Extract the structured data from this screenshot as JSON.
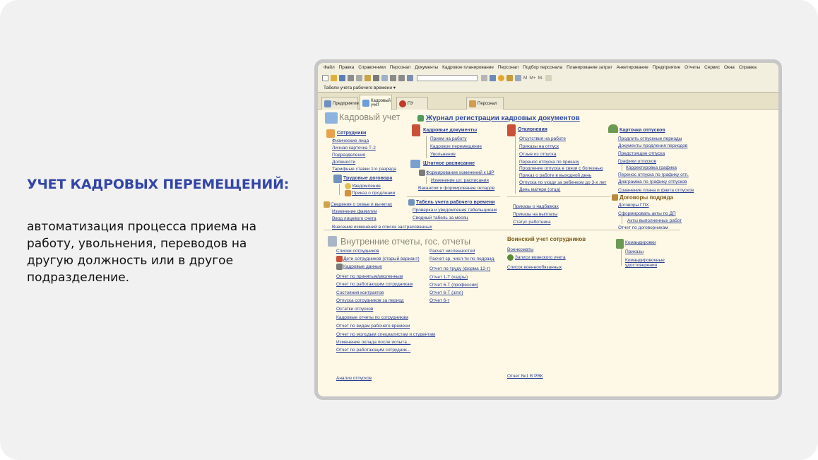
{
  "slide": {
    "title": "УЧЕТ КАДРОВЫХ ПЕРЕМЕЩЕНИЙ:",
    "description": "автоматизация процесса приема на работу, увольнения, переводов на другую должность или в другое подразделение."
  },
  "menu": [
    "Файл",
    "Правка",
    "Справочники",
    "Персонал",
    "Документы",
    "Кадровое планирование",
    "Персонал",
    "Подбор персонала",
    "Планирование затрат",
    "Анкетирование",
    "Предприятие",
    "Отчеты",
    "Сервис",
    "Окна",
    "Справка"
  ],
  "toolbar": {
    "mplus": "M",
    "mplus2": "M+",
    "mminus": "M-"
  },
  "subtoolbar": "Табели учета рабочего времени ▾",
  "tabs": [
    "Предприятие",
    "Кадровый учет",
    "ПУ",
    "Персонал"
  ],
  "header": {
    "title": "Кадровый учет",
    "journal": "Журнал регистрации кадровых документов"
  },
  "col1": {
    "heading": "Сотрудники",
    "links": [
      "Физические лица",
      "Личная карточка Т-2",
      "Подразделения",
      "Должности",
      "Тарифные ставки 1го разряда"
    ],
    "labor_heading": "Трудовые договора",
    "labor_links": [
      "Уведомление",
      "Приказ о продлении"
    ],
    "family": "Сведения о семье и вычетах",
    "family_links": [
      "Изменение фамилии",
      "Ввод лицевого счета"
    ],
    "changes": "Внесение изменений в список застрахованных"
  },
  "col2": {
    "heading": "Кадровые документы",
    "links": [
      "Прием на работу",
      "Кадровое перемещение",
      "Увольнение"
    ],
    "staff_heading": "Штатное расписание",
    "staff_links": [
      "Формирование изменений к ШР",
      "Изменение шт. расписания",
      "Вакансии и формирование окладов"
    ],
    "timesheet_heading": "Табель учета рабочего времени",
    "timesheet_links": [
      "Проверка и уведомления табельщикам",
      "Сводный табель за месяц"
    ]
  },
  "col3": {
    "heading": "Отклонения",
    "links": [
      "Отсутствия на работе",
      "Приказы на отпуск",
      "Отзыв из отпуска",
      "Перенос отпуска по приказу",
      "Продление отпуска в связи с болезнью",
      "Приказ о работе в выходной день",
      "Отпуска по уходу за ребенком до 3-х лет",
      "День матери (отца)"
    ],
    "bottom_links": [
      "Приказы о надбавках",
      "Приказы на выплаты",
      "Статус работника"
    ]
  },
  "col4": {
    "heading": "Карточка отпусков",
    "links": [
      "Продлить отпускные периоды",
      "Документы продления периодов",
      "Предстоящие отпуска",
      "Графики отпусков",
      "Корректировка графика",
      "Перенос отпуска по графику отп.",
      "Диаграмма по графику отпусков",
      "Сравнение плана и факта отпусков"
    ],
    "contracts_heading": "Договоры подряда",
    "contracts_links": [
      "Договоры ГПХ",
      "Сформировать акты по ДП",
      "Акты выполненных работ",
      "Отчет по договорникам"
    ]
  },
  "reports": {
    "title": "Внутренние отчеты, гос. отчеты",
    "left": [
      "Списки сотрудников",
      "Дети сотрудников (старый вариант)",
      "Кадровые данные",
      "Отчет по принятым/уволенным",
      "Отчет по работающим сотрудникам",
      "Состояния контрактов",
      "Отпуска сотрудников за период",
      "Остатки отпусков",
      "Кадровые отчеты по сотрудникам",
      "Отчет по видам рабочего времени",
      "Отчет по молодым специалистам и студентам",
      "Изменение оклада после испыта...",
      "Отчет по работающим сотрудник..."
    ],
    "left_bottom": "Анализ отпусков",
    "mid": [
      "Расчет численностей",
      "Расчет ср. числ-ти по подразд.",
      "Отчет по труду (форма 12-т)",
      "Отчет 1-Т (кадры)",
      "Отчет 6-Т (профессии)",
      "Отчет 6-Т (з/пл)",
      "Отчет 6-т"
    ],
    "military_title": "Воинский учет сотрудников",
    "military_links": [
      "Военкоматы",
      "Записи воинского учета",
      "Список военнообязанных"
    ],
    "military_bottom": "Отчет №1 В РВК",
    "trips_heading": "Командировки",
    "trips_links": [
      "Приказы",
      "Командировочные удостоверения"
    ]
  },
  "colors": {
    "title": "#3346a6",
    "link": "#2a3d95",
    "app_bg": "#fdf9e6"
  }
}
